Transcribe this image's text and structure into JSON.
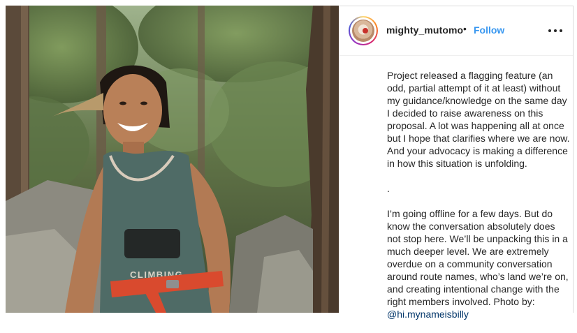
{
  "post": {
    "username": "mighty_mutomo",
    "separator": "•",
    "follow_label": "Follow",
    "more_icon": "more-options-icon",
    "avatar_icon": "profile-avatar",
    "caption": {
      "para1": "Project released a flagging feature (an odd, partial attempt of it at least) without my guidance/knowledge on the same day I decided to raise awareness on this proposal. A lot was happening all at once but I hope that clarifies where we are now. And your advocacy is making a difference in how this situation is unfolding.",
      "divider": ".",
      "para2": "I’m going offline for a few days. But do know the conversation absolutely does not stop here. We’ll be unpacking this in a much deeper level. We are extremely overdue on a community conversation around route names, who’s land we’re on, and creating intentional change with the right members involved. Photo by:",
      "mention": "@hi.mynameisbilly"
    },
    "photo": {
      "shirt_text": "CLIMBING",
      "colors": {
        "forest": "#4d5a3a",
        "shirt": "#4f6b66",
        "harness": "#d94a2e",
        "skin": "#b07a55"
      }
    }
  },
  "theme": {
    "text": "#262626",
    "link_blue": "#3897f0",
    "mention_blue": "#003569"
  }
}
